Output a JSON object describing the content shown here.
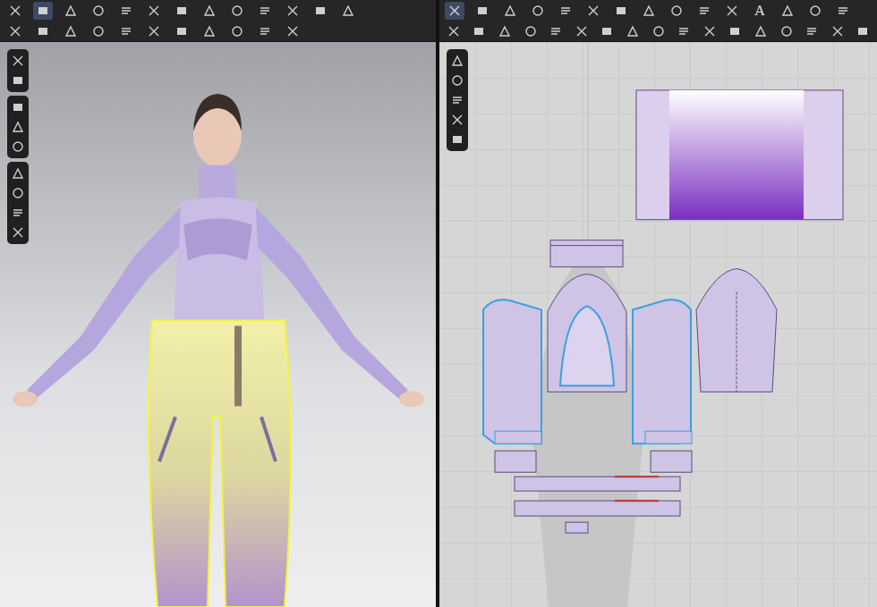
{
  "viewport_3d": {
    "toolbar_rows": [
      [
        {
          "selected": false
        },
        {
          "selected": true
        },
        {
          "selected": false
        },
        {
          "selected": false
        },
        {
          "selected": false
        },
        {
          "selected": false
        },
        {
          "selected": false
        },
        {
          "selected": false
        },
        {
          "selected": false
        },
        {
          "selected": false
        },
        {
          "selected": false
        },
        {
          "selected": false
        },
        {
          "selected": false
        }
      ],
      [
        {
          "selected": false
        },
        {
          "selected": false
        },
        {
          "selected": false
        },
        {
          "selected": false
        },
        {
          "selected": false
        },
        {
          "selected": false
        },
        {
          "selected": false
        },
        {
          "selected": false
        },
        {
          "selected": false
        },
        {
          "selected": false
        },
        {
          "selected": false
        }
      ]
    ],
    "side_toolbar_groups": [
      [
        {
          "selected": false
        },
        {
          "selected": false
        }
      ],
      [
        {
          "selected": false
        },
        {
          "selected": false
        },
        {
          "selected": false
        }
      ],
      [
        {
          "selected": false
        },
        {
          "selected": false
        },
        {
          "selected": false
        },
        {
          "selected": false
        }
      ]
    ]
  },
  "pattern_2d": {
    "toolbar_rows": [
      [
        {
          "selected": true
        },
        {
          "selected": false
        },
        {
          "selected": false
        },
        {
          "selected": false
        },
        {
          "selected": false
        },
        {
          "selected": false
        },
        {
          "selected": false
        },
        {
          "selected": false
        },
        {
          "selected": false
        },
        {
          "selected": false
        },
        {
          "selected": false
        },
        {
          "label": "A",
          "selected": false
        },
        {
          "selected": false
        },
        {
          "selected": false
        },
        {
          "selected": false
        }
      ],
      [
        {
          "selected": false
        },
        {
          "selected": false
        },
        {
          "selected": false
        },
        {
          "selected": false
        },
        {
          "selected": false
        },
        {
          "selected": false
        },
        {
          "selected": false
        },
        {
          "selected": false
        },
        {
          "selected": false
        },
        {
          "selected": false
        },
        {
          "selected": false
        },
        {
          "selected": false
        },
        {
          "selected": false
        },
        {
          "selected": false
        },
        {
          "selected": false
        },
        {
          "selected": false
        },
        {
          "selected": false
        }
      ]
    ],
    "side_toolbar": [
      {
        "selected": false
      },
      {
        "selected": false
      },
      {
        "selected": false
      },
      {
        "selected": false
      },
      {
        "selected": false
      }
    ]
  }
}
